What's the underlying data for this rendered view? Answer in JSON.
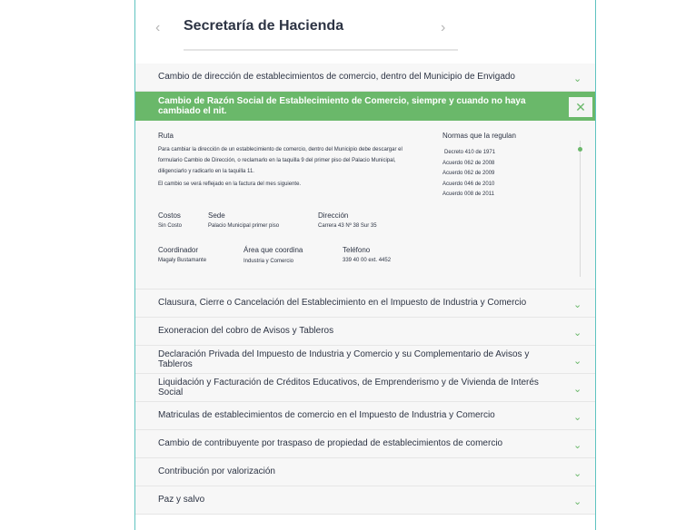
{
  "header": {
    "title": "Secretaría de Hacienda",
    "prev_icon": "‹",
    "next_icon": "›"
  },
  "accordion": {
    "item_0": "Cambio de dirección de establecimientos de comercio, dentro del Municipio de Envigado",
    "open_title": "Cambio de Razón Social de Establecimiento de Comercio, siempre y cuando no haya cambiado el nit.",
    "close_icon": "✕",
    "chevron_icon": "⌄",
    "ruta_label": "Ruta",
    "ruta_text": "Para cambiar la dirección de un establecimiento de comercio, dentro del Municipio debe descargar el formulario Cambio de Dirección, o reclamarlo en la taquilla 9 del primer piso del Palacio Municipal, diligenciarlo y radicarlo en la taquilla 11.",
    "ruta_note": "El cambio se verá reflejado en la factura del mes siguiente.",
    "normas_label": "Normas que la regulan",
    "normas": [
      "Decreto 410 de 1971",
      "Acuerdo 062 de 2008",
      "Acuerdo 062 de 2009",
      "Acuerdo 046 de 2010",
      "Acuerdo 008 de 2011"
    ],
    "costos_label": "Costos",
    "costos_value": "Sin Costo",
    "sede_label": "Sede",
    "sede_value": "Palacio Municipal primer piso",
    "direccion_label": "Dirección",
    "direccion_value": "Carrera 43 Nº 38 Sur 35",
    "coordinador_label": "Coordinador",
    "coordinador_value": "Magaly Bustamante",
    "area_label": "Área que coordina",
    "area_value": "Industria y Comercio",
    "telefono_label": "Teléfono",
    "telefono_value": "339 40 00 ext. 4452",
    "item_2": "Clausura, Cierre o Cancelación del Establecimiento en el Impuesto de Industria y Comercio",
    "item_3": "Exoneracion del cobro de Avisos y Tableros",
    "item_4": "Declaración Privada del Impuesto de Industria y Comercio y su Complementario de Avisos y Tableros",
    "item_5": "Liquidación y Facturación de Créditos Educativos, de Emprenderismo y de Vivienda de Interés Social",
    "item_6": "Matriculas de establecimientos de comercio en el Impuesto de Industria y Comercio",
    "item_7": "Cambio de contribuyente por traspaso de propiedad de establecimientos de comercio",
    "item_8": "Contribución por valorización",
    "item_9": "Paz y salvo"
  }
}
